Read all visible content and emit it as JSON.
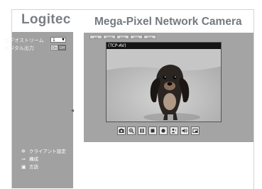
{
  "brand": {
    "logo": "Logitec"
  },
  "header": {
    "title": "Mega-Pixel Network Camera"
  },
  "sidebar": {
    "stream_label": "ビデオストリーム",
    "stream_value": "1",
    "digital_output_label": "デジタル出力",
    "on_label": "On",
    "off_label": "Off",
    "menu": [
      {
        "label": "クライアント設定",
        "icon": "gear-icon"
      },
      {
        "label": "構成",
        "icon": "wrench-icon"
      },
      {
        "label": "言語",
        "icon": "language-icon"
      }
    ]
  },
  "main": {
    "resolution_tabs": [
      "1/4",
      "100%",
      "50%",
      "25%",
      "12%"
    ],
    "video_label": "(TCP-AV)",
    "toolbar": [
      {
        "icon": "snapshot-icon"
      },
      {
        "icon": "zoom-icon"
      },
      {
        "icon": "pause-icon"
      },
      {
        "icon": "stop-icon"
      },
      {
        "icon": "record-icon"
      },
      {
        "icon": "talk-icon"
      },
      {
        "icon": "speaker-icon"
      },
      {
        "icon": "fullscreen-icon"
      }
    ]
  },
  "colors": {
    "sidebar_bg": "#a1a1a1",
    "panel_bg": "#a4a4a4",
    "title_text": "#747a80"
  }
}
